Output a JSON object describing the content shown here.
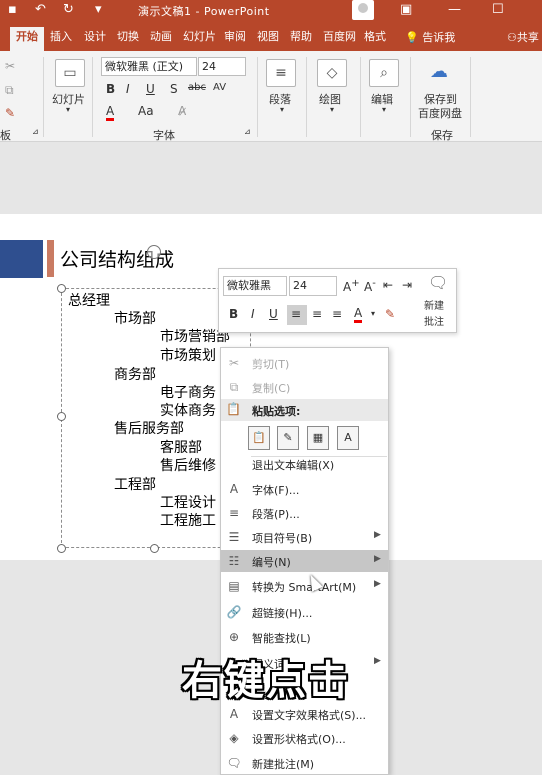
{
  "titlebar": {
    "title": "演示文稿1 - PowerPoint",
    "icons": [
      "save-icon",
      "undo-icon",
      "redo-icon",
      "presentation-start-icon",
      "customize-icon"
    ]
  },
  "tabs": [
    "开始",
    "插入",
    "设计",
    "切换",
    "动画",
    "幻灯片",
    "审阅",
    "视图",
    "帮助",
    "百度网",
    "格式"
  ],
  "tell_me": "告诉我",
  "share": "共享",
  "ribbon": {
    "slides_label": "幻灯片",
    "font_name": "微软雅黑 (正文)",
    "font_size": "24",
    "font_group": "字体",
    "paragraph": "段落",
    "drawing": "绘图",
    "editing": "编辑",
    "save_baidu_line1": "保存到",
    "save_baidu_line2": "百度网盘",
    "save_group": "保存",
    "clipboard_fragment": "板"
  },
  "slide": {
    "title": "公司结构组成",
    "org": [
      {
        "text": "总经理",
        "level": 0
      },
      {
        "text": "市场部",
        "level": 1
      },
      {
        "text": "市场营销部",
        "level": 2
      },
      {
        "text": "市场策划",
        "level": 2
      },
      {
        "text": "商务部",
        "level": 1
      },
      {
        "text": "电子商务",
        "level": 2
      },
      {
        "text": "实体商务",
        "level": 2
      },
      {
        "text": "售后服务部",
        "level": 1
      },
      {
        "text": "客服部",
        "level": 2
      },
      {
        "text": "售后维修",
        "level": 2
      },
      {
        "text": "工程部",
        "level": 1
      },
      {
        "text": "工程设计",
        "level": 2
      },
      {
        "text": "工程施工",
        "level": 2
      }
    ]
  },
  "mini_toolbar": {
    "font_name": "微软雅黑",
    "font_size": "24",
    "new_comment_line1": "新建",
    "new_comment_line2": "批注"
  },
  "context_menu": {
    "cut": "剪切(T)",
    "copy": "复制(C)",
    "paste_options": "粘贴选项:",
    "exit_edit": "退出文本编辑(X)",
    "font": "字体(F)...",
    "paragraph": "段落(P)...",
    "bullets": "项目符号(B)",
    "numbering": "编号(N)",
    "convert_smartart": "转换为 SmartArt(M)",
    "hyperlink": "超链接(H)...",
    "smart_lookup": "智能查找(L)",
    "synonyms": "同义词",
    "text_effects": "设置文字效果格式(S)...",
    "shape_format": "设置形状格式(O)...",
    "new_comment": "新建批注(M)"
  },
  "caption": "右键点击"
}
